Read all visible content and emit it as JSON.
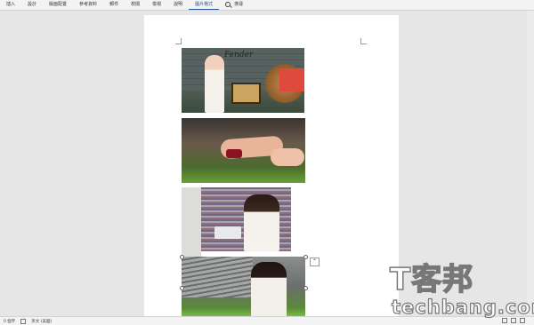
{
  "ribbon": {
    "tabs": [
      {
        "label": "插入"
      },
      {
        "label": "設計"
      },
      {
        "label": "版面配置"
      },
      {
        "label": "參考資料"
      },
      {
        "label": "郵件"
      },
      {
        "label": "校閱"
      },
      {
        "label": "檢視"
      },
      {
        "label": "說明"
      },
      {
        "label": "圖片格式"
      }
    ],
    "active_tab": "圖片格式",
    "search_label": "搜尋",
    "search_icon": "search-icon",
    "accent_color": "#2b579a"
  },
  "document": {
    "photos": [
      {
        "name": "fender-amp-photo",
        "logo_text": "Fender"
      },
      {
        "name": "wristband-photo"
      },
      {
        "name": "woman-tablet-photo"
      },
      {
        "name": "woman-headphones-photo"
      }
    ],
    "layout_options_icon": "layout-options-icon"
  },
  "status_bar": {
    "page_count": "0 個字",
    "language": "英文 (美國)"
  },
  "watermark": {
    "text_cn": "T客邦",
    "text_en": "techbang.com"
  }
}
